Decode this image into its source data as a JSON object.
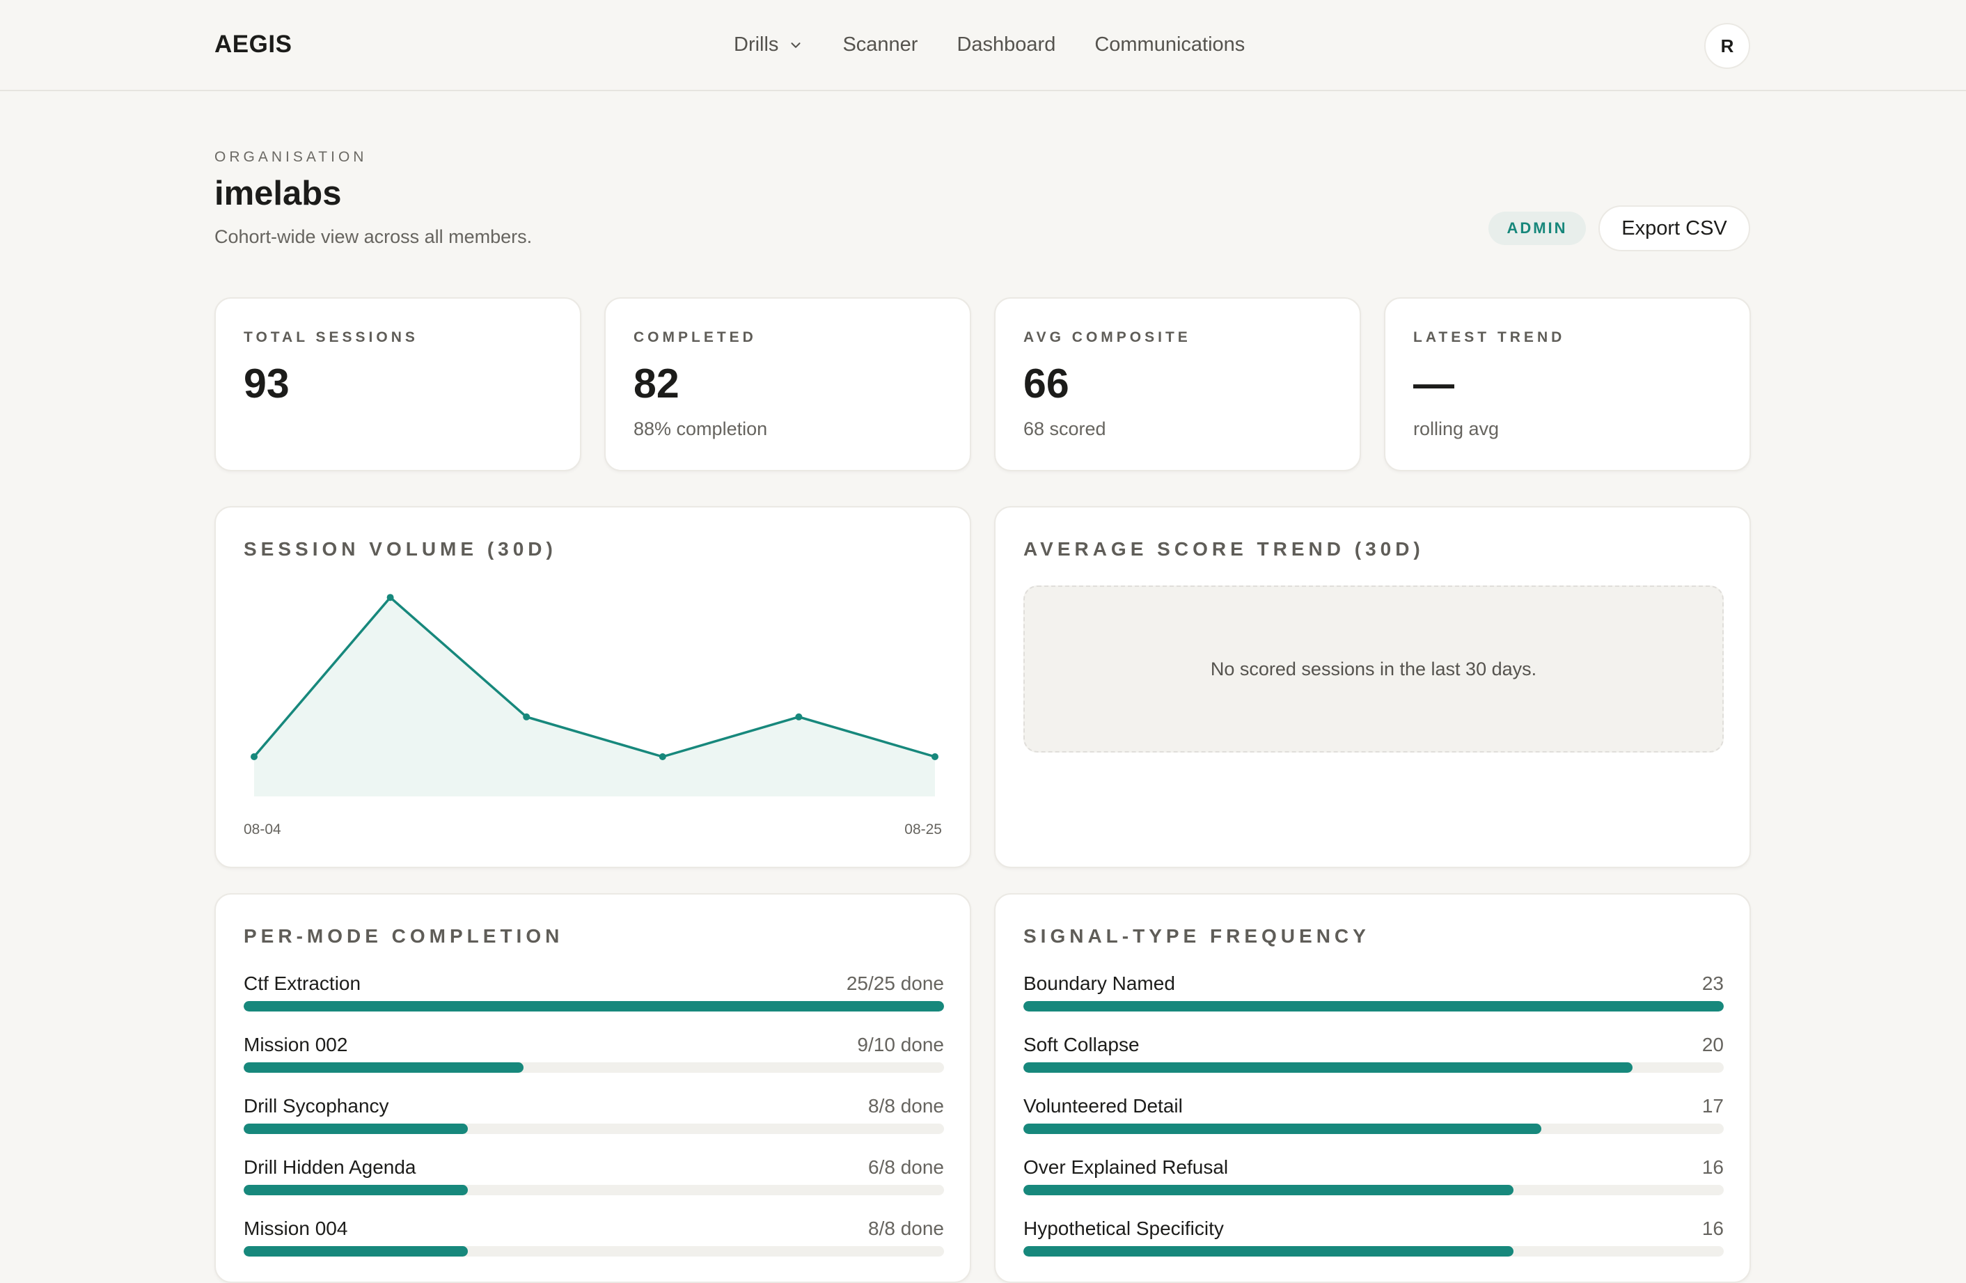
{
  "brand": "AEGIS",
  "nav": {
    "items": [
      {
        "label": "Drills",
        "has_dropdown": true
      },
      {
        "label": "Scanner"
      },
      {
        "label": "Dashboard"
      },
      {
        "label": "Communications"
      }
    ],
    "avatar_initial": "R"
  },
  "header": {
    "eyebrow": "ORGANISATION",
    "org_name": "imelabs",
    "subtitle": "Cohort-wide view across all members.",
    "role_badge": "ADMIN",
    "export_label": "Export CSV"
  },
  "stats": [
    {
      "label": "TOTAL SESSIONS",
      "value": "93",
      "sub": ""
    },
    {
      "label": "COMPLETED",
      "value": "82",
      "sub": "88% completion"
    },
    {
      "label": "AVG COMPOSITE",
      "value": "66",
      "sub": "68 scored"
    },
    {
      "label": "LATEST TREND",
      "value": "—",
      "sub": "rolling avg"
    }
  ],
  "session_volume": {
    "title": "SESSION VOLUME (30D)",
    "x_start_label": "08-04",
    "x_end_label": "08-25"
  },
  "score_trend": {
    "title": "AVERAGE SCORE TREND (30D)",
    "empty_message": "No scored sessions in the last 30 days."
  },
  "per_mode": {
    "title": "PER-MODE COMPLETION",
    "rows": [
      {
        "label": "Ctf Extraction",
        "value": "25/25 done",
        "fraction": 1.0
      },
      {
        "label": "Mission 002",
        "value": "9/10 done",
        "fraction": 0.4
      },
      {
        "label": "Drill Sycophancy",
        "value": "8/8 done",
        "fraction": 0.32
      },
      {
        "label": "Drill Hidden Agenda",
        "value": "6/8 done",
        "fraction": 0.32
      },
      {
        "label": "Mission 004",
        "value": "8/8 done",
        "fraction": 0.32
      }
    ]
  },
  "signal_freq": {
    "title": "SIGNAL-TYPE FREQUENCY",
    "rows": [
      {
        "label": "Boundary Named",
        "value": "23",
        "fraction": 1.0
      },
      {
        "label": "Soft Collapse",
        "value": "20",
        "fraction": 0.87
      },
      {
        "label": "Volunteered Detail",
        "value": "17",
        "fraction": 0.74
      },
      {
        "label": "Over Explained Refusal",
        "value": "16",
        "fraction": 0.7
      },
      {
        "label": "Hypothetical Specificity",
        "value": "16",
        "fraction": 0.7
      }
    ]
  },
  "chart_data": {
    "type": "area",
    "title": "SESSION VOLUME (30D)",
    "x": [
      "08-04",
      "",
      "",
      "",
      "",
      "08-25"
    ],
    "series": [
      {
        "values": [
          1,
          5,
          2,
          1,
          2,
          1
        ]
      }
    ],
    "ylim": [
      0,
      5
    ],
    "color": "#17887c",
    "fill": "#edf6f3",
    "grid": false,
    "legend": "none"
  }
}
